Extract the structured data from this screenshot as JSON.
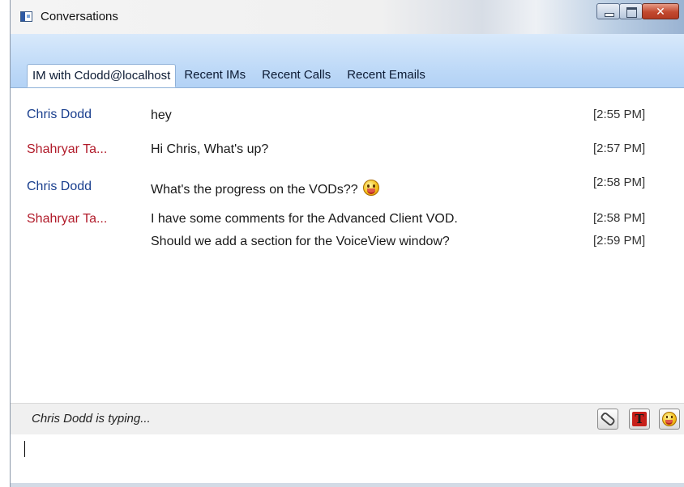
{
  "window": {
    "title": "Conversations",
    "controls": {
      "minimize": "minimize-icon",
      "maximize": "maximize-icon",
      "close": "close-icon"
    }
  },
  "tabs": [
    {
      "label": "IM with Cdodd@localhost",
      "active": true
    },
    {
      "label": "Recent IMs",
      "active": false
    },
    {
      "label": "Recent Calls",
      "active": false
    },
    {
      "label": "Recent Emails",
      "active": false
    }
  ],
  "messages": [
    {
      "sender": "Chris Dodd",
      "sender_color": "#1a3f8e",
      "text": "hey",
      "time": "[2:55 PM]"
    },
    {
      "sender": "Shahryar Ta...",
      "sender_color": "#b11b2a",
      "text": "Hi Chris, What's up?",
      "time": "[2:57 PM]"
    },
    {
      "sender": "Chris Dodd",
      "sender_color": "#1a3f8e",
      "text": "What's the progress on the VODs??",
      "emoji": "smiley-icon",
      "time": "[2:58 PM]"
    },
    {
      "sender": "Shahryar Ta...",
      "sender_color": "#b11b2a",
      "text": "I have some comments for the Advanced Client VOD.",
      "time": "[2:58 PM]"
    },
    {
      "sender": "",
      "text": "Should we add a section for the VoiceView window?",
      "time": "[2:59 PM]"
    }
  ],
  "status": {
    "typing_text": "Chris Dodd is typing...",
    "tools": [
      "attach-file-icon",
      "font-format-icon",
      "emoticon-icon"
    ]
  },
  "composer": {
    "value": ""
  }
}
